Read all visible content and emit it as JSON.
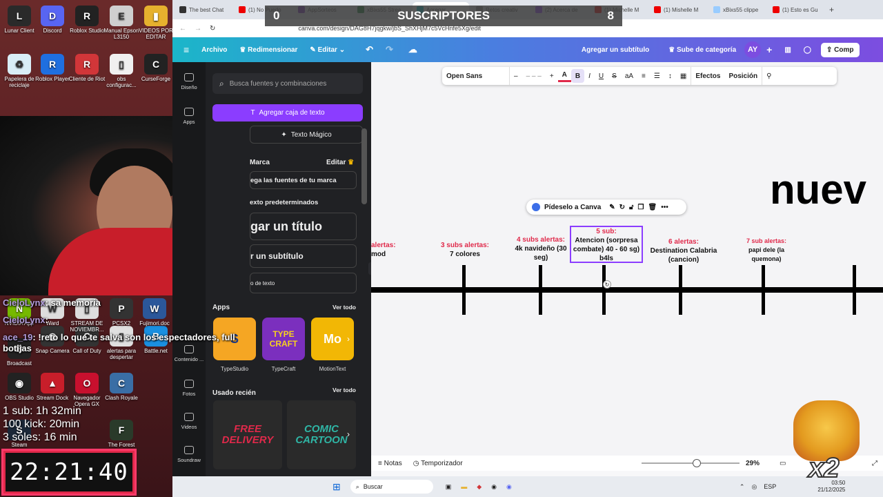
{
  "desktop": {
    "icons": [
      {
        "label": "Lunar Client",
        "color": "#2a2a2a",
        "glyph": "L"
      },
      {
        "label": "Discord",
        "color": "#5865f2",
        "glyph": "D"
      },
      {
        "label": "Roblox Studio",
        "color": "#222",
        "glyph": "R"
      },
      {
        "label": "Manual Epson L3150",
        "color": "#cfcfcf",
        "glyph": "E"
      },
      {
        "label": "VIDEOS POR EDITAR",
        "color": "#e6b12e",
        "glyph": "▮"
      },
      {
        "label": "Papelera de reciclaje",
        "color": "#d9eef7",
        "glyph": "♻"
      },
      {
        "label": "Roblox Player",
        "color": "#1f6fe0",
        "glyph": "R"
      },
      {
        "label": "Cliente de Riot",
        "color": "#d13639",
        "glyph": "R"
      },
      {
        "label": "obs configurac...",
        "color": "#f0f0f0",
        "glyph": "▯"
      },
      {
        "label": "CurseForge",
        "color": "#222",
        "glyph": "C"
      },
      {
        "label": "Snap Camera",
        "color": "#333",
        "glyph": "◉"
      },
      {
        "label": "Call of Duty",
        "color": "#333",
        "glyph": "C"
      },
      {
        "label": "alertas para despertar",
        "color": "#e0e0e0",
        "glyph": "▯"
      },
      {
        "label": "Battle.net",
        "color": "#1a8fe0",
        "glyph": "B"
      },
      {
        "label": "OBS Studio",
        "color": "#222",
        "glyph": "◉"
      },
      {
        "label": "Stream Dock",
        "color": "#c81e2a",
        "glyph": "▲"
      },
      {
        "label": "Navegador Opera GX",
        "color": "#c8102e",
        "glyph": "O"
      },
      {
        "label": "Clash Royale",
        "color": "#3a6ea5",
        "glyph": "C"
      },
      {
        "label": "Steam",
        "color": "#1b2838",
        "glyph": "S"
      },
      {
        "label": "The Forest",
        "color": "#2a3a2a",
        "glyph": "F"
      },
      {
        "label": "Fujimori.doc",
        "color": "#2b579a",
        "glyph": "W"
      },
      {
        "label": "Broadcast",
        "color": "#222",
        "glyph": "B"
      },
      {
        "label": "NVIDIA App",
        "color": "#76b900",
        "glyph": "N"
      },
      {
        "label": "Ward",
        "color": "#ddd",
        "glyph": "W"
      },
      {
        "label": "STREAM DE NOVIEMBR...",
        "color": "#ddd",
        "glyph": "▯"
      },
      {
        "label": "PCSX2",
        "color": "#333",
        "glyph": "P"
      }
    ]
  },
  "chat": [
    {
      "user": "CieloLynx",
      "text": ": sa memoria"
    },
    {
      "user": "CieloLynx",
      "text": ":"
    },
    {
      "user": "ace_19",
      "text": ": !reto lo que te salva son los espectadores, full botijas"
    }
  ],
  "stream_info": {
    "lines": [
      "1 sub: 1h 32min",
      "100 kick: 20min",
      "3 soles: 16 min"
    ],
    "timer": "22:21:40"
  },
  "subs_overlay": {
    "left": "0",
    "title": "SUSCRIPTORES",
    "right": "8"
  },
  "browser": {
    "tabs": [
      {
        "label": "The best Chat",
        "color": "#333"
      },
      {
        "label": "(1) No Puedo",
        "color": "#e00"
      },
      {
        "label": "AppSorteos",
        "color": "#7b2fbe"
      },
      {
        "label": "xBixs55 Strea",
        "color": "#1a7f3a"
      },
      {
        "label": "Agregar",
        "color": "#00c4cc"
      },
      {
        "label": "Retos creativ",
        "color": "#888"
      },
      {
        "label": "(2) Acerca de",
        "color": "#9146ff"
      },
      {
        "label": "(1) Michelle M",
        "color": "#e00"
      },
      {
        "label": "(1) Mishelle M",
        "color": "#e00"
      },
      {
        "label": "xBixs55 clippe",
        "color": "#9cf"
      },
      {
        "label": "(1) Esto es Gu",
        "color": "#e00"
      }
    ],
    "url": "canva.com/design/DAG8H7jqgkw/jbS_ShXHjM7c5VcHnfe5Xg/edit"
  },
  "canva": {
    "header": {
      "menu_icon": "menu-icon",
      "file": "Archivo",
      "resize": "Redimensionar",
      "edit": "Editar",
      "title": "Agregar un subtítulo",
      "upgrade": "Sube de categoría",
      "avatar": "AY",
      "share": "Comp"
    },
    "rail": [
      {
        "label": "Diseño"
      },
      {
        "label": "Apps"
      },
      {
        "label": "Contenido ..."
      },
      {
        "label": "Fotos"
      },
      {
        "label": "Videos"
      },
      {
        "label": "Soundraw"
      }
    ],
    "panel": {
      "search_placeholder": "Busca fuentes y combinaciones",
      "add_textbox": "Agregar caja de texto",
      "magic_text": "Texto Mágico",
      "brand_heading": "Marca",
      "brand_edit": "Editar",
      "brand_fonts": "ega las fuentes de tu marca",
      "default_styles": "exto predeterminados",
      "add_title": "gar un título",
      "add_subtitle": "r un subtítulo",
      "add_body": "o de texto",
      "apps_heading": "Apps",
      "apps_see_all": "Ver todo",
      "apps": [
        {
          "label": "TypeStudio",
          "bg": "#f5a623",
          "fg": "#1a3a8a",
          "glyph": "S"
        },
        {
          "label": "TypeCraft",
          "bg": "#7b2fbe",
          "fg": "#f7d21e",
          "glyph": "TYPE CRAFT"
        },
        {
          "label": "MotionText",
          "bg": "#f2b705",
          "fg": "#fff",
          "glyph": "Mo"
        }
      ],
      "recent_heading": "Usado recién",
      "recent_see_all": "Ver todo",
      "recent": [
        {
          "label": "FREE DELIVERY",
          "bg": "#2a2a2a",
          "fg": "#e0294a"
        },
        {
          "label": "COMIC CARTOON",
          "bg": "#2a2a2a",
          "fg": "#2fb5a5"
        }
      ]
    },
    "toolbar": {
      "font": "Open Sans",
      "minus": "–",
      "size": "– – –",
      "plus": "+",
      "effects": "Efectos",
      "position": "Posición"
    },
    "pide": "Pídeselo a Canva",
    "timeline_labels": [
      {
        "red": "alertas:",
        "black": "mod"
      },
      {
        "red": "3 subs alertas:",
        "black": "7 colores"
      },
      {
        "red": "4 subs alertas:",
        "black": "4k navideño (30 seg)"
      },
      {
        "red": "5 sub:",
        "black": "Atencion (sorpresa combate) 40 -  60 sg) b4ls"
      },
      {
        "red": "6 alertas:",
        "black": "Destination Calabria (cancion)"
      },
      {
        "red": "7 sub alertas:",
        "black": "papi dele (la quemona)"
      }
    ],
    "big_word": "nuev",
    "footer": {
      "notes": "Notas",
      "timer": "Temporizador",
      "zoom": "29%",
      "zoom_level": 0.56
    }
  },
  "taskbar": {
    "search": "Buscar",
    "lang": "ESP",
    "time": "03:50",
    "date": "21/12/2025"
  },
  "overlay": {
    "multiplier": "x2"
  }
}
